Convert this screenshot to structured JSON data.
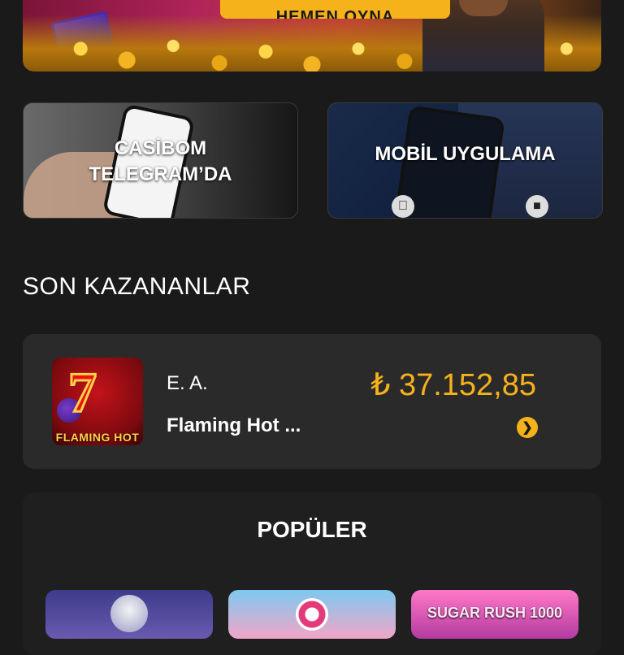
{
  "hero": {
    "cta_label": "HEMEN OYNA"
  },
  "promos": [
    {
      "title_line1": "CASİBOM",
      "title_line2": "TELEGRAM’DA"
    },
    {
      "title": "MOBİL UYGULAMA"
    }
  ],
  "recent_winners": {
    "title": "SON KAZANANLAR",
    "items": [
      {
        "user": "E. A.",
        "game": "Flaming Hot ...",
        "game_badge": "FLAMING HOT",
        "amount": "₺ 37.152,85"
      }
    ]
  },
  "popular": {
    "title": "POPÜLER",
    "tiles": [
      {
        "label": ""
      },
      {
        "label": ""
      },
      {
        "label": "SUGAR RUSH 1000"
      }
    ]
  },
  "colors": {
    "background": "#1a1a1b",
    "card": "#2a2a2b",
    "accent": "#f5b21a"
  }
}
